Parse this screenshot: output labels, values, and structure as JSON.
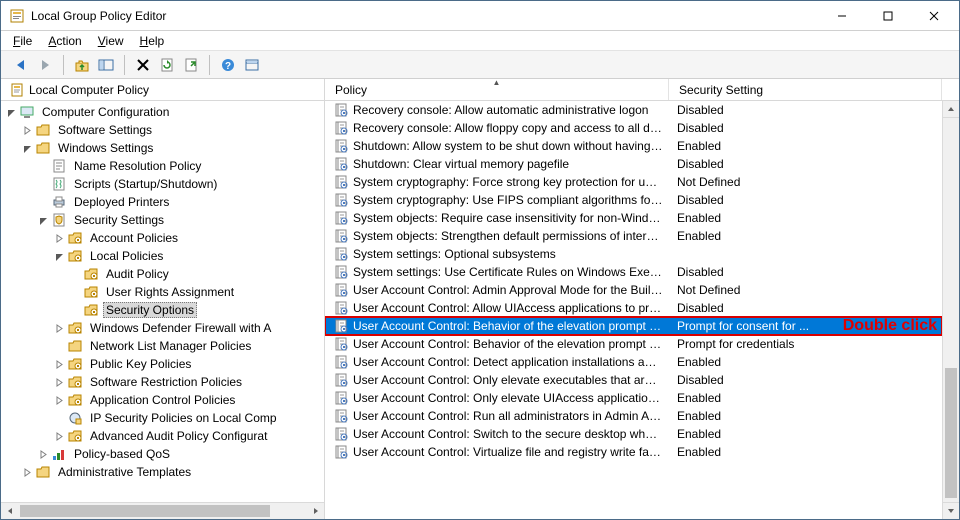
{
  "window": {
    "title": "Local Group Policy Editor"
  },
  "menu": {
    "file": "File",
    "action": "Action",
    "view": "View",
    "help": "Help"
  },
  "tree_header": "Local Computer Policy",
  "tree": [
    {
      "ind": 1,
      "twist": "open",
      "icon": "pc",
      "label": "Computer Configuration"
    },
    {
      "ind": 2,
      "twist": "closed",
      "icon": "folder",
      "label": "Software Settings"
    },
    {
      "ind": 2,
      "twist": "open",
      "icon": "folder",
      "label": "Windows Settings"
    },
    {
      "ind": 3,
      "twist": "none",
      "icon": "doc",
      "label": "Name Resolution Policy"
    },
    {
      "ind": 3,
      "twist": "none",
      "icon": "scroll",
      "label": "Scripts (Startup/Shutdown)"
    },
    {
      "ind": 3,
      "twist": "none",
      "icon": "printer",
      "label": "Deployed Printers"
    },
    {
      "ind": 3,
      "twist": "open",
      "icon": "sec",
      "label": "Security Settings"
    },
    {
      "ind": 4,
      "twist": "closed",
      "icon": "folderl",
      "label": "Account Policies"
    },
    {
      "ind": 4,
      "twist": "open",
      "icon": "folderl",
      "label": "Local Policies"
    },
    {
      "ind": 5,
      "twist": "none",
      "icon": "folderl",
      "label": "Audit Policy"
    },
    {
      "ind": 5,
      "twist": "none",
      "icon": "folderl",
      "label": "User Rights Assignment"
    },
    {
      "ind": 5,
      "twist": "none",
      "icon": "folderl",
      "label": "Security Options",
      "sel": true
    },
    {
      "ind": 4,
      "twist": "closed",
      "icon": "folderl",
      "label": "Windows Defender Firewall with A"
    },
    {
      "ind": 4,
      "twist": "none",
      "icon": "folder",
      "label": "Network List Manager Policies"
    },
    {
      "ind": 4,
      "twist": "closed",
      "icon": "folderl",
      "label": "Public Key Policies"
    },
    {
      "ind": 4,
      "twist": "closed",
      "icon": "folderl",
      "label": "Software Restriction Policies"
    },
    {
      "ind": 4,
      "twist": "closed",
      "icon": "folderl",
      "label": "Application Control Policies"
    },
    {
      "ind": 4,
      "twist": "none",
      "icon": "ipsec",
      "label": "IP Security Policies on Local Comp"
    },
    {
      "ind": 4,
      "twist": "closed",
      "icon": "folderl",
      "label": "Advanced Audit Policy Configurat"
    },
    {
      "ind": 3,
      "twist": "closed",
      "icon": "qos",
      "label": "Policy-based QoS"
    },
    {
      "ind": 2,
      "twist": "closed",
      "icon": "folder",
      "label": "Administrative Templates"
    }
  ],
  "columns": {
    "policy": "Policy",
    "setting": "Security Setting"
  },
  "rows": [
    {
      "name": "Recovery console: Allow automatic administrative logon",
      "value": "Disabled"
    },
    {
      "name": "Recovery console: Allow floppy copy and access to all drives...",
      "value": "Disabled"
    },
    {
      "name": "Shutdown: Allow system to be shut down without having to...",
      "value": "Enabled"
    },
    {
      "name": "Shutdown: Clear virtual memory pagefile",
      "value": "Disabled"
    },
    {
      "name": "System cryptography: Force strong key protection for user k...",
      "value": "Not Defined"
    },
    {
      "name": "System cryptography: Use FIPS compliant algorithms for en...",
      "value": "Disabled"
    },
    {
      "name": "System objects: Require case insensitivity for non-Windows ...",
      "value": "Enabled"
    },
    {
      "name": "System objects: Strengthen default permissions of internal s...",
      "value": "Enabled"
    },
    {
      "name": "System settings: Optional subsystems",
      "value": ""
    },
    {
      "name": "System settings: Use Certificate Rules on Windows Executabl...",
      "value": "Disabled"
    },
    {
      "name": "User Account Control: Admin Approval Mode for the Built-i...",
      "value": "Not Defined"
    },
    {
      "name": "User Account Control: Allow UIAccess applications to prom...",
      "value": "Disabled"
    },
    {
      "name": "User Account Control: Behavior of the elevation prompt for ...",
      "value": "Prompt for consent for ...",
      "sel": true
    },
    {
      "name": "User Account Control: Behavior of the elevation prompt for ...",
      "value": "Prompt for credentials"
    },
    {
      "name": "User Account Control: Detect application installations and p...",
      "value": "Enabled"
    },
    {
      "name": "User Account Control: Only elevate executables that are sign...",
      "value": "Disabled"
    },
    {
      "name": "User Account Control: Only elevate UIAccess applications th...",
      "value": "Enabled"
    },
    {
      "name": "User Account Control: Run all administrators in Admin Appr...",
      "value": "Enabled"
    },
    {
      "name": "User Account Control: Switch to the secure desktop when pr...",
      "value": "Enabled"
    },
    {
      "name": "User Account Control: Virtualize file and registry write failure...",
      "value": "Enabled"
    }
  ],
  "annotation": "Double click",
  "toolbar_icons": [
    "back",
    "forward",
    "up",
    "pane",
    "delete",
    "refresh",
    "export",
    "help",
    "props"
  ]
}
